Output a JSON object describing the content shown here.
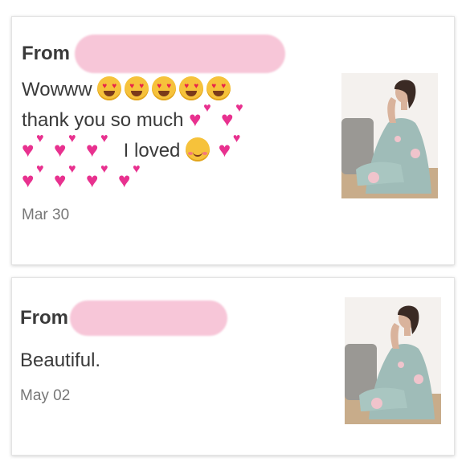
{
  "messages": [
    {
      "from_label": "From",
      "text_lines": [
        "Wowww",
        "thank you so much",
        "I loved"
      ],
      "date": "Mar 30",
      "emoji": [
        "heart-eyes-emoji",
        "smiling-face-with-hearts-emoji",
        "two-hearts-emoji"
      ]
    },
    {
      "from_label": "From",
      "text": "Beautiful.",
      "date": "May 02"
    }
  ],
  "colors": {
    "redaction": "#f7c6d8",
    "text": "#3a3a3a",
    "date": "#777777",
    "hearts": "#e8318f",
    "emoji_face": "#f6c23b",
    "robe": "#9fbcb8",
    "background_wall": "#f4f1ee"
  }
}
